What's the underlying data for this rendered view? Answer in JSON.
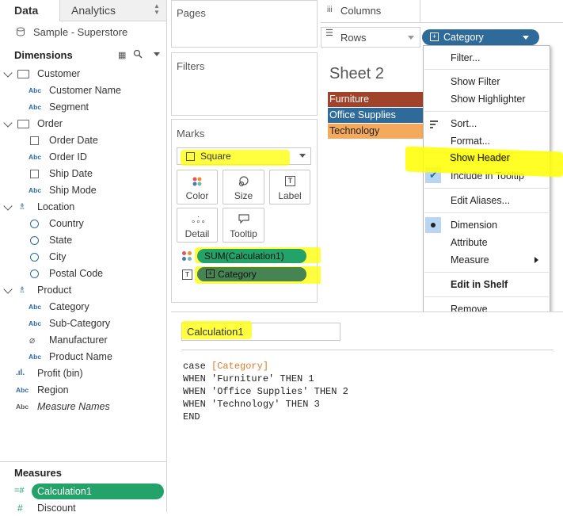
{
  "tabs": {
    "data": "Data",
    "analytics": "Analytics"
  },
  "source": {
    "name": "Sample - Superstore"
  },
  "dimensions": {
    "title": "Dimensions",
    "groups": [
      {
        "label": "Customer",
        "items": [
          "Customer Name",
          "Segment"
        ]
      },
      {
        "label": "Order",
        "items": [
          "Order Date",
          "Order ID",
          "Ship Date",
          "Ship Mode"
        ]
      },
      {
        "label": "Location",
        "items": [
          "Country",
          "State",
          "City",
          "Postal Code"
        ]
      },
      {
        "label": "Product",
        "items": [
          "Category",
          "Sub-Category",
          "Manufacturer",
          "Product Name"
        ]
      }
    ],
    "extra": [
      "Profit (bin)",
      "Region",
      "Measure Names"
    ]
  },
  "measures": {
    "title": "Measures",
    "items": [
      "Calculation1",
      "Discount"
    ]
  },
  "shelves": {
    "pages": "Pages",
    "filters": "Filters",
    "columns": "Columns",
    "rows": "Rows",
    "rows_pill": "Category"
  },
  "marks": {
    "title": "Marks",
    "mark_type": "Square",
    "buttons": {
      "color": "Color",
      "size": "Size",
      "label": "Label",
      "detail": "Detail",
      "tooltip": "Tooltip"
    },
    "pill_color": "SUM(Calculation1)",
    "pill_label": "Category"
  },
  "sheet": {
    "title": "Sheet 2",
    "rows": [
      {
        "label": "Furniture",
        "color": "#a0432a"
      },
      {
        "label": "Office Supplies",
        "color": "#2f6b9a"
      },
      {
        "label": "Technology",
        "color": "#f5a95c"
      }
    ]
  },
  "context_menu": {
    "filter": "Filter...",
    "show_filter": "Show Filter",
    "show_highlighter": "Show Highlighter",
    "sort": "Sort...",
    "format": "Format...",
    "show_header": "Show Header",
    "include_in_tooltip": "Include in Tooltip",
    "edit_aliases": "Edit Aliases...",
    "dimension": "Dimension",
    "attribute": "Attribute",
    "measure": "Measure",
    "edit_in_shelf": "Edit in Shelf",
    "remove": "Remove"
  },
  "calc_editor": {
    "name": "Calculation1",
    "line1_kw": "case",
    "line1_field": "[Category]",
    "line2": "WHEN 'Furniture' THEN 1",
    "line3": "WHEN 'Office Supplies' THEN 2",
    "line4": "WHEN 'Technology' THEN 3",
    "line5": "END"
  },
  "colors": {
    "green_pill": "#23a369",
    "blue_pill": "#2f6b9a",
    "highlight": "#ffff00"
  }
}
